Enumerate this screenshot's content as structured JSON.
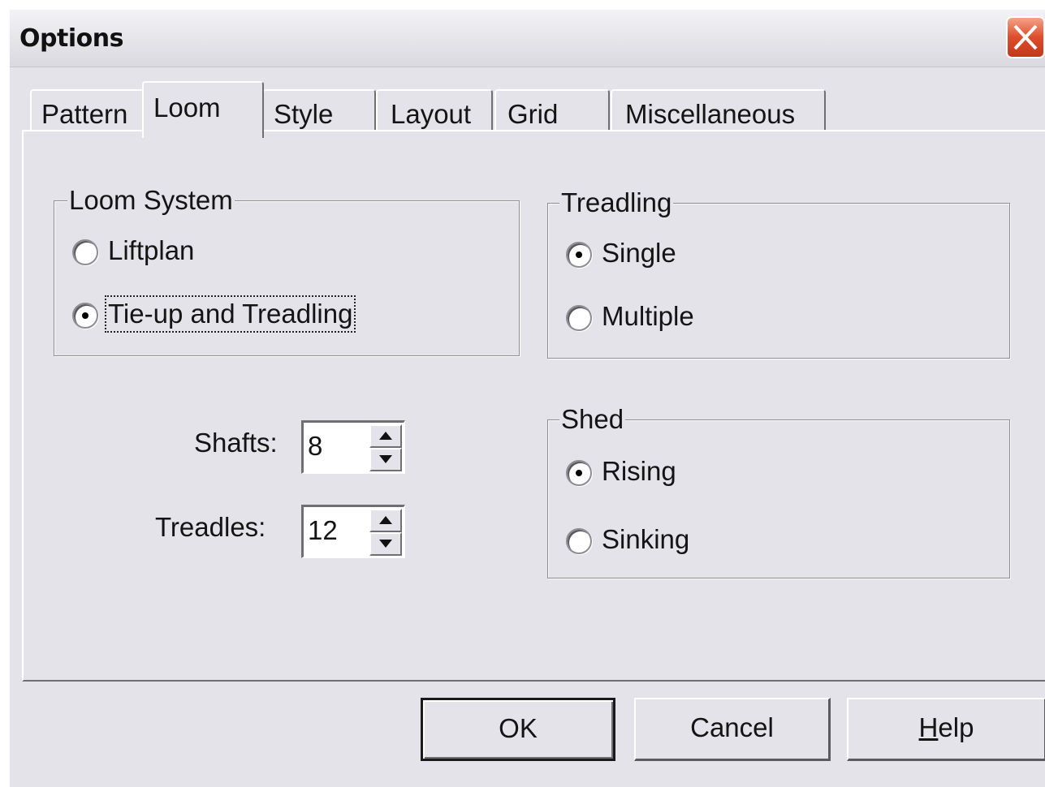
{
  "window": {
    "title": "Options"
  },
  "tabs": [
    {
      "label": "Pattern",
      "active": false
    },
    {
      "label": "Loom",
      "active": true
    },
    {
      "label": "Style",
      "active": false
    },
    {
      "label": "Layout",
      "active": false
    },
    {
      "label": "Grid",
      "active": false
    },
    {
      "label": "Miscellaneous",
      "active": false
    }
  ],
  "loom_system": {
    "title": "Loom System",
    "options": [
      {
        "label": "Liftplan",
        "checked": false
      },
      {
        "label": "Tie-up and Treadling",
        "checked": true
      }
    ]
  },
  "treadling": {
    "title": "Treadling",
    "options": [
      {
        "label": "Single",
        "checked": true
      },
      {
        "label": "Multiple",
        "checked": false
      }
    ]
  },
  "shed": {
    "title": "Shed",
    "options": [
      {
        "label": "Rising",
        "checked": true
      },
      {
        "label": "Sinking",
        "checked": false
      }
    ]
  },
  "shafts": {
    "label": "Shafts:",
    "value": "8"
  },
  "treadles": {
    "label": "Treadles:",
    "value": "12"
  },
  "buttons": {
    "ok": "OK",
    "cancel": "Cancel",
    "help_letter": "H",
    "help_rest": "elp"
  },
  "icons": {
    "close": "close-icon",
    "spin_up": "arrow-up-icon",
    "spin_down": "arrow-down-icon"
  },
  "colors": {
    "face": "#e4e3e9",
    "close_button": "#dd4d2a"
  }
}
